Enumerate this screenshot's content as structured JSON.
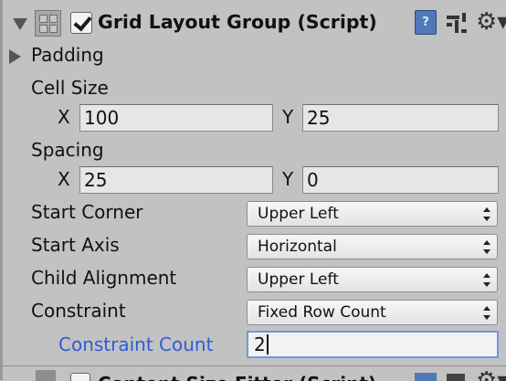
{
  "component": {
    "title": "Grid Layout Group (Script)",
    "enabled": true,
    "help_icon_glyph": "?",
    "gear_icon_glyph": "⚙▾"
  },
  "padding": {
    "label": "Padding",
    "expanded": false
  },
  "cell_size": {
    "label": "Cell Size",
    "x_label": "X",
    "x_value": "100",
    "y_label": "Y",
    "y_value": "25"
  },
  "spacing": {
    "label": "Spacing",
    "x_label": "X",
    "x_value": "25",
    "y_label": "Y",
    "y_value": "0"
  },
  "start_corner": {
    "label": "Start Corner",
    "value": "Upper Left"
  },
  "start_axis": {
    "label": "Start Axis",
    "value": "Horizontal"
  },
  "child_alignment": {
    "label": "Child Alignment",
    "value": "Upper Left"
  },
  "constraint": {
    "label": "Constraint",
    "value": "Fixed Row Count"
  },
  "constraint_count": {
    "label": "Constraint Count",
    "value": "2"
  },
  "next_component": {
    "title": "Content Size Fitter (Script)"
  },
  "colors": {
    "panel_bg": "#c2c2c2",
    "focus_blue": "#2f5bd6",
    "focus_border": "#6f98d8",
    "help_icon": "#4f79b7"
  }
}
